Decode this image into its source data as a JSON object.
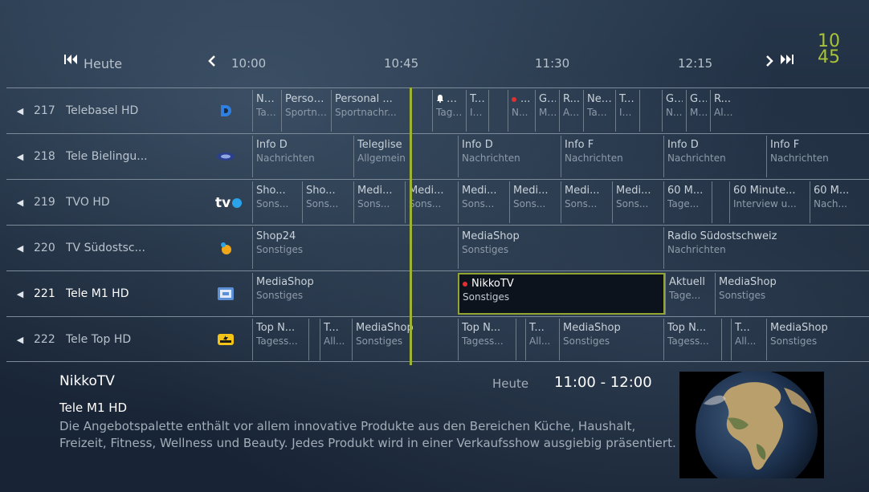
{
  "header": {
    "first_icon": "skip-back-icon",
    "day_label": "Heute",
    "prev_icon": "chevron-left-icon",
    "time_slots": [
      "10:00",
      "10:45",
      "11:30",
      "12:15"
    ],
    "next_icon": "chevron-right-icon",
    "last_icon": "skip-forward-icon",
    "clock_hour": "10",
    "clock_minute": "45"
  },
  "colors": {
    "accent": "#9fb332",
    "recording": "#e03030"
  },
  "channels": [
    {
      "num": "217",
      "name": "Telebasel HD",
      "logo_icon": "telebasel-logo",
      "programs": [
        {
          "title": "New...",
          "genre": "Tage..."
        },
        {
          "title": "Person...",
          "genre": "Sportna..."
        },
        {
          "title": "Personal ...",
          "genre": "Sportnachr..."
        },
        {
          "title": "N...",
          "genre": "Tage...",
          "icon": "bell-icon"
        },
        {
          "title": "Talk",
          "genre": "Int..."
        },
        {
          "title": "",
          "genre": ""
        },
        {
          "title": "...",
          "genre": "N...",
          "recording": true
        },
        {
          "title": "G...",
          "genre": "M..."
        },
        {
          "title": "R...",
          "genre": "All..."
        },
        {
          "title": "New...",
          "genre": "Tage..."
        },
        {
          "title": "Talk",
          "genre": "Int..."
        },
        {
          "title": "",
          "genre": ""
        },
        {
          "title": "Gl...",
          "genre": "N..."
        },
        {
          "title": "G...",
          "genre": "M..."
        },
        {
          "title": "R...",
          "genre": "All..."
        }
      ]
    },
    {
      "num": "218",
      "name": "Tele Bielingu...",
      "logo_icon": "telebielingue-logo",
      "programs": [
        {
          "title": "Info D",
          "genre": "Nachrichten"
        },
        {
          "title": "Teleglise",
          "genre": "Allgemein"
        },
        {
          "title": "Info D",
          "genre": "Nachrichten"
        },
        {
          "title": "Info F",
          "genre": "Nachrichten"
        },
        {
          "title": "Info D",
          "genre": "Nachrichten"
        },
        {
          "title": "Info F",
          "genre": "Nachrichten"
        }
      ]
    },
    {
      "num": "219",
      "name": "TVO HD",
      "logo_icon": "tvo-logo",
      "programs": [
        {
          "title": "Sho...",
          "genre": "Sons..."
        },
        {
          "title": "Sho...",
          "genre": "Sons..."
        },
        {
          "title": "Medi...",
          "genre": "Sons..."
        },
        {
          "title": "Medi...",
          "genre": "Sons..."
        },
        {
          "title": "Medi...",
          "genre": "Sons..."
        },
        {
          "title": "Medi...",
          "genre": "Sons..."
        },
        {
          "title": "Medi...",
          "genre": "Sons..."
        },
        {
          "title": "Medi...",
          "genre": "Sons..."
        },
        {
          "title": "60 M...",
          "genre": "Tage..."
        },
        {
          "title": "",
          "genre": ""
        },
        {
          "title": "60 Minute...",
          "genre": "Interview u..."
        },
        {
          "title": "60 M...",
          "genre": "Nach..."
        }
      ]
    },
    {
      "num": "220",
      "name": "TV Südostsc...",
      "logo_icon": "tvsudostschweiz-logo",
      "programs": [
        {
          "title": "Shop24",
          "genre": "Sonstiges"
        },
        {
          "title": "MediaShop",
          "genre": "Sonstiges"
        },
        {
          "title": "Radio Südostschweiz",
          "genre": "Nachrichten"
        }
      ]
    },
    {
      "num": "221",
      "name": "Tele M1 HD",
      "logo_icon": "telem1-logo",
      "programs": [
        {
          "title": "MediaShop",
          "genre": "Sonstiges"
        },
        {
          "title": "NikkoTV",
          "genre": "Sonstiges",
          "recording": true
        },
        {
          "title": "Aktuell",
          "genre": "Tage..."
        },
        {
          "title": "MediaShop",
          "genre": "Sonstiges"
        }
      ]
    },
    {
      "num": "222",
      "name": "Tele Top HD",
      "logo_icon": "teletop-logo",
      "programs": [
        {
          "title": "Top N...",
          "genre": "Tagess..."
        },
        {
          "title": "",
          "genre": ""
        },
        {
          "title": "T...",
          "genre": "All..."
        },
        {
          "title": "MediaShop",
          "genre": "Sonstiges"
        },
        {
          "title": "Top N...",
          "genre": "Tagess..."
        },
        {
          "title": "",
          "genre": ""
        },
        {
          "title": "T...",
          "genre": "All..."
        },
        {
          "title": "MediaShop",
          "genre": "Sonstiges"
        },
        {
          "title": "Top N...",
          "genre": "Tagess..."
        },
        {
          "title": "",
          "genre": ""
        },
        {
          "title": "T...",
          "genre": "All..."
        },
        {
          "title": "MediaShop",
          "genre": "Sonstiges"
        }
      ]
    }
  ],
  "details": {
    "title": "NikkoTV",
    "channel": "Tele M1 HD",
    "day": "Heute",
    "time": "11:00 - 12:00",
    "description": "Die Angebotspalette enthält vor allem innovative Produkte aus den Bereichen Küche, Haushalt, Freizeit, Fitness, Wellness und Beauty. Jedes Produkt wird in einer Verkaufsshow ausgiebig präsentiert."
  }
}
